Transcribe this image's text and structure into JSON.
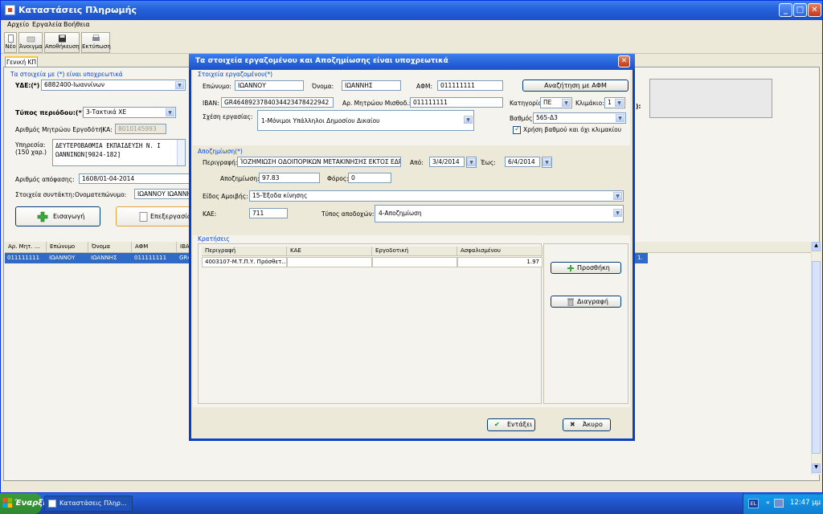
{
  "window": {
    "title": "Καταστάσεις Πληρωμής"
  },
  "menu": [
    "Αρχείο",
    "Εργαλεία",
    "Βοήθεια"
  ],
  "toolbar": {
    "new": "Νέο",
    "open": "Άνοιγμα",
    "save": "Αποθήκευση",
    "print": "Εκτύπωση"
  },
  "tab": "Γενική ΚΠ",
  "main": {
    "required_note": "Τα στοιχεία με (*) είναι υποχρεωτικά",
    "yde_label": "ΥΔΕ:(*)",
    "yde_value": "6882400-Ιωαννίνων",
    "period_label": "Τύπος περιόδου:(*)",
    "period_value": "3-Τακτικά ΧΕ",
    "employer_label": "Αριθμός Μητρώου Εργοδότη:",
    "ika_label": "ΙΚΑ:",
    "ika_value": "8010145993",
    "service_label": "Υπηρεσία:",
    "service_sub": "(150 χαρ.)",
    "service_line1": "ΔΕΥΤΕΡΟΒΑΘΜΙΑ ΕΚΠΑΙΔΕΥΣΗ Ν. Ι",
    "service_line2": "ΩΑΝΝΙΝΩΝ[9024-182]",
    "decision_label": "Αριθμός απόφασης:",
    "decision_value": "1608/01-04-2014",
    "composer_label": "Στοιχεία συντάκτη:",
    "name_label": "Ονοματεπώνυμο:",
    "name_value": "ΙΩΑΝΝΟΥ ΙΩΑΝΝΗ",
    "insert_btn": "Εισαγωγή",
    "edit_btn": "Επεξεργασία",
    "right_label": "):",
    "table_headers": [
      "Αρ. Μητ. ...",
      "Επώνυμο",
      "Όνομα",
      "ΑΦΜ",
      "ΙΒΑ"
    ],
    "table_row": [
      "011111111",
      "ΙΩΑΝΝΟΥ",
      "ΙΩΑΝΝΗΣ",
      "011111111",
      "GR4"
    ],
    "row_tail": "1."
  },
  "dialog": {
    "title": "Τα στοιχεία εργαζομένου και Αποζημίωσης είναι υποχρεωτικά",
    "employee": {
      "title": "Στοιχεία εργαζομένου(*)",
      "surname_label": "Επώνυμο:",
      "surname": "ΙΩΑΝΝΟΥ",
      "firstname_label": "Όνομα:",
      "firstname": "ΙΩΑΝΝΗΣ",
      "afm_label": "ΑΦΜ:",
      "afm": "011111111",
      "search_btn": "Αναζήτηση με ΑΦΜ",
      "iban_label": "IBAN:",
      "iban": "GR4648923784034423478422942",
      "payroll_label": "Αρ. Μητρώου Μισθοδ.:",
      "payroll": "011111111",
      "category_label": "Κατηγορία:",
      "category": "ΠΕ",
      "scale_label": "Κλιμάκιο:",
      "scale": "1",
      "relation_label": "Σχέση εργασίας:",
      "relation": "1-Μόνιμοι Υπάλληλοι Δημοσίου Δικαίου",
      "grade_label": "Βαθμός:",
      "grade": "565-Δ3",
      "use_grade": "Χρήση βαθμού και όχι κλιμακίου"
    },
    "compensation": {
      "title": "Αποζημίωση(*)",
      "desc_label": "Περιγραφή:",
      "desc": "ΊΟΖΗΜΙΩΣΗ ΟΔΟΙΠΟΡΙΚΩΝ ΜΕΤΑΚΙΝΗΣΗΣ ΕΚΤΟΣ ΕΔΡΑΣ",
      "from_label": "Από:",
      "from": "3/4/2014",
      "to_label": "Έως:",
      "to": "6/4/2014",
      "amount_label": "Αποζημίωση:",
      "amount": "97.83",
      "tax_label": "Φόρος:",
      "tax": "0",
      "type_label": "Είδος Αμοιβής:",
      "type": "15-Έξοδα κίνησης",
      "kae_label": "ΚΑΕ:",
      "kae": "711",
      "income_label": "Τύπος αποδοχών:",
      "income": "4-Αποζημίωση"
    },
    "deductions": {
      "title": "Κρατήσεις",
      "headers": [
        "Περιγραφή",
        "ΚΑΕ",
        "Εργοδοτική",
        "Ασφαλισμένου"
      ],
      "row": [
        "4003107-Μ.Τ.Π.Υ. Πρόσθετ...",
        "",
        "",
        "1.97"
      ],
      "add_btn": "Προσθήκη",
      "delete_btn": "Διαγραφή"
    },
    "ok_btn": "Εντάξει",
    "cancel_btn": "Άκυρο"
  },
  "taskbar": {
    "start": "Έναρξη",
    "task": "Καταστάσεις Πληρ...",
    "lang": "EL",
    "clock": "12:47 μμ"
  }
}
